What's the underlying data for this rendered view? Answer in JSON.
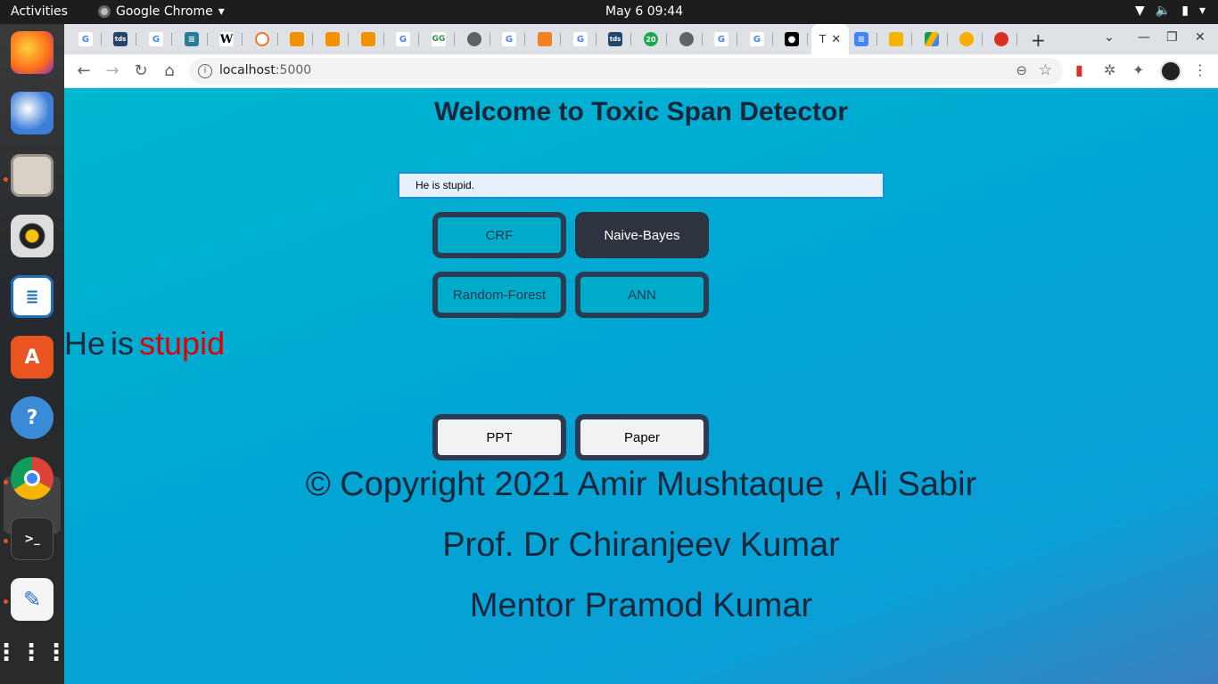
{
  "system": {
    "activities": "Activities",
    "app_name": "Google Chrome",
    "clock": "May 6  09:44"
  },
  "browser": {
    "active_tab_title": "T",
    "url_host": "localhost",
    "url_port": ":5000"
  },
  "page": {
    "title": "Welcome to Toxic Span Detector",
    "input_value": "He is stupid.",
    "models": [
      "CRF",
      "Naive-Bayes",
      "Random-Forest",
      "ANN"
    ],
    "selected_model": "Naive-Bayes",
    "result_tokens": [
      {
        "text": "He",
        "toxic": false
      },
      {
        "text": "is",
        "toxic": false
      },
      {
        "text": "stupid",
        "toxic": true
      }
    ],
    "links": {
      "ppt": "PPT",
      "paper": "Paper"
    },
    "credits": {
      "copyright": "© Copyright 2021 Amir Mushtaque , Ali Sabir",
      "professor": "Prof. Dr Chiranjeev Kumar",
      "mentor": "Mentor Pramod Kumar"
    },
    "colors": {
      "toxic": "#e00000",
      "selected_button": "#2d3440"
    }
  }
}
